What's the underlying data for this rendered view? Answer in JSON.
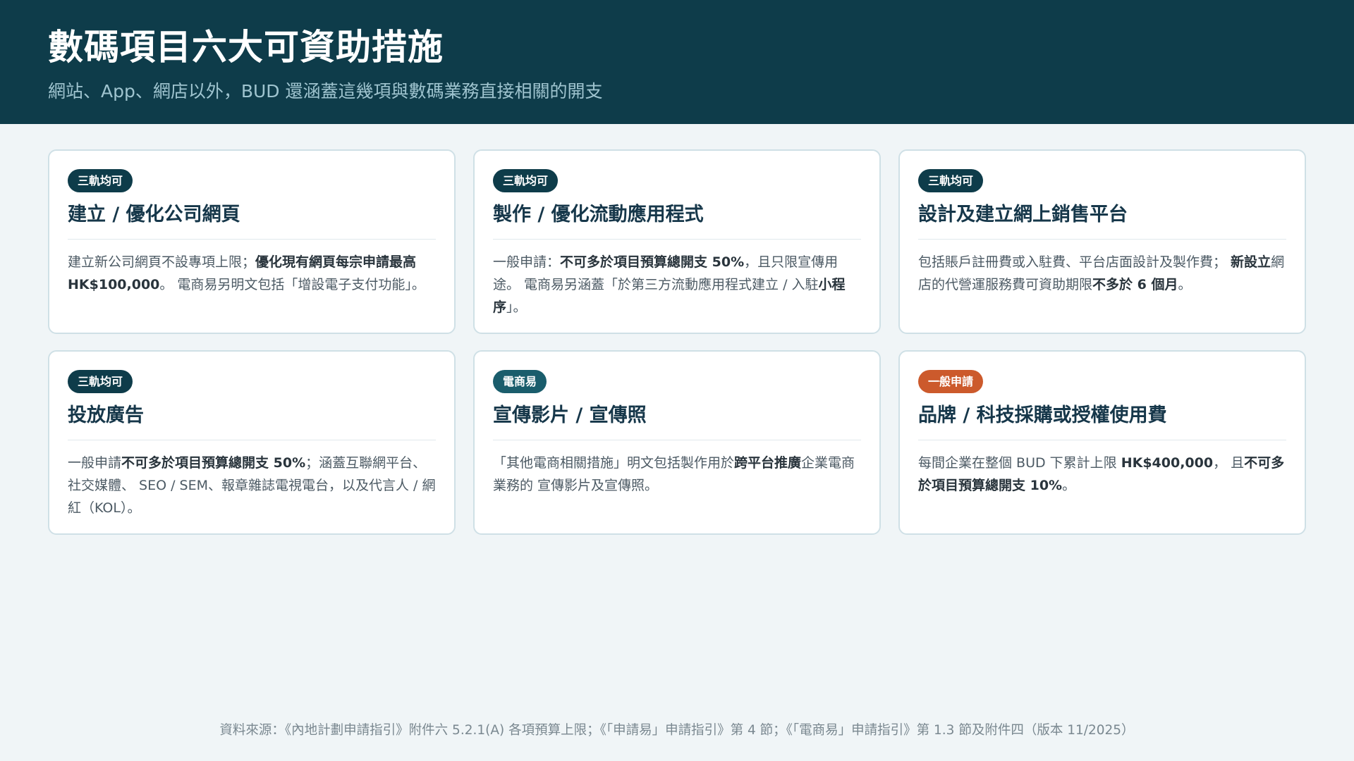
{
  "header": {
    "title": "數碼項目六大可資助措施",
    "subtitle": "網站、App、網店以外，BUD 還涵蓋這幾項與數碼業務直接相關的開支"
  },
  "colors": {
    "header_bg": "#0e3c4a",
    "badge_all_tracks": "#0e3c4a",
    "badge_ecommerce": "#1a5d6c",
    "badge_general": "#cc5a2c",
    "page_bg": "#f0f5f7"
  },
  "cards": [
    {
      "badge": "三軌均可",
      "title": "建立 / 優化公司網頁",
      "body": [
        {
          "t": "建立新公司網頁不設專項上限；",
          "b": false
        },
        {
          "t": "優化現有網頁每宗申請最高 HK$100,000",
          "b": true
        },
        {
          "t": "。 電商易另明文包括「增設電子支付功能」。",
          "b": false
        }
      ]
    },
    {
      "badge": "三軌均可",
      "title": "製作 / 優化流動應用程式",
      "body": [
        {
          "t": "一般申請：",
          "b": false
        },
        {
          "t": "不可多於項目預算總開支 50%",
          "b": true
        },
        {
          "t": "，且只限宣傳用途。 電商易另涵蓋「於第三方流動應用程式建立 / 入駐",
          "b": false
        },
        {
          "t": "小程序",
          "b": true
        },
        {
          "t": "」。",
          "b": false
        }
      ]
    },
    {
      "badge": "三軌均可",
      "title": "設計及建立網上銷售平台",
      "body": [
        {
          "t": "包括賬戶註冊費或入駐費、平台店面設計及製作費； ",
          "b": false
        },
        {
          "t": "新設立",
          "b": true
        },
        {
          "t": "網店的代營運服務費可資助期限",
          "b": false
        },
        {
          "t": "不多於 6 個月",
          "b": true
        },
        {
          "t": "。",
          "b": false
        }
      ]
    },
    {
      "badge": "三軌均可",
      "title": "投放廣告",
      "body": [
        {
          "t": "一般申請",
          "b": false
        },
        {
          "t": "不可多於項目預算總開支 50%",
          "b": true
        },
        {
          "t": "；涵蓋互聯網平台、社交媒體、 SEO / SEM、報章雜誌電視電台，以及代言人 / 網紅（KOL）。",
          "b": false
        }
      ]
    },
    {
      "badge": "電商易",
      "title": "宣傳影片 / 宣傳照",
      "body": [
        {
          "t": "「其他電商相關措施」明文包括製作用於",
          "b": false
        },
        {
          "t": "跨平台推廣",
          "b": true
        },
        {
          "t": "企業電商業務的 宣傳影片及宣傳照。",
          "b": false
        }
      ]
    },
    {
      "badge": "一般申請",
      "title": "品牌 / 科技採購或授權使用費",
      "body": [
        {
          "t": "每間企業在整個 BUD 下累計上限 ",
          "b": false
        },
        {
          "t": "HK$400,000",
          "b": true
        },
        {
          "t": "， 且",
          "b": false
        },
        {
          "t": "不可多於項目預算總開支 10%",
          "b": true
        },
        {
          "t": "。",
          "b": false
        }
      ]
    }
  ],
  "footer": {
    "source": "資料來源：《內地計劃申請指引》附件六 5.2.1(A) 各項預算上限；《「申請易」申請指引》第 4 節；《「電商易」申請指引》第 1.3 節及附件四（版本 11/2025）"
  }
}
